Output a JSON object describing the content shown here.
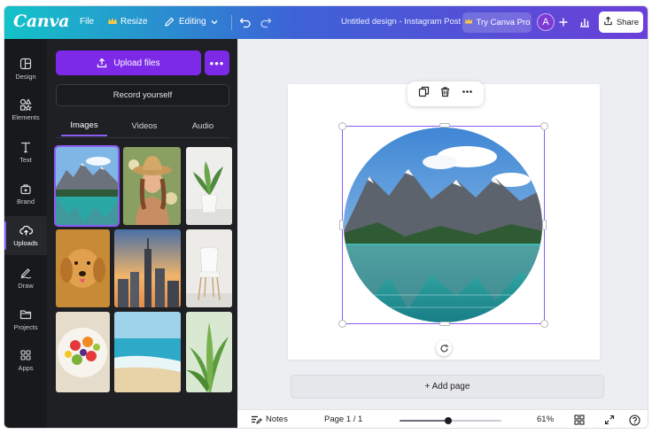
{
  "header": {
    "logo": "Canva",
    "menu_file": "File",
    "menu_resize": "Resize",
    "mode": "Editing",
    "design_title": "Untitled design - Instagram Post",
    "pro_label": "Try Canva Pro",
    "avatar_initial": "A",
    "share_label": "Share"
  },
  "rail": {
    "items": [
      {
        "label": "Design",
        "icon": "layout-icon"
      },
      {
        "label": "Elements",
        "icon": "shapes-icon"
      },
      {
        "label": "Text",
        "icon": "text-icon"
      },
      {
        "label": "Brand",
        "icon": "brand-icon"
      },
      {
        "label": "Uploads",
        "icon": "cloud-upload-icon",
        "active": true
      },
      {
        "label": "Draw",
        "icon": "pen-icon"
      },
      {
        "label": "Projects",
        "icon": "folder-icon"
      },
      {
        "label": "Apps",
        "icon": "apps-icon"
      }
    ]
  },
  "panel": {
    "upload_label": "Upload files",
    "more_label": "•••",
    "record_label": "Record yourself",
    "tabs": [
      "Images",
      "Videos",
      "Audio"
    ],
    "active_tab": "Images",
    "images": [
      {
        "name": "lake-mountains",
        "selected": true
      },
      {
        "name": "woman-hat"
      },
      {
        "name": "potted-plant"
      },
      {
        "name": "golden-retriever"
      },
      {
        "name": "city-skyline"
      },
      {
        "name": "white-chair"
      },
      {
        "name": "fruit-bowl"
      },
      {
        "name": "beach"
      },
      {
        "name": "green-plant"
      }
    ]
  },
  "canvas": {
    "add_page_label": "+ Add page"
  },
  "footer": {
    "notes_label": "Notes",
    "page_indicator": "Page 1 / 1",
    "zoom_label": "61%",
    "zoom_fraction": 0.48
  },
  "colors": {
    "accent": "#7d2ae8",
    "selection": "#8b5cf6"
  }
}
